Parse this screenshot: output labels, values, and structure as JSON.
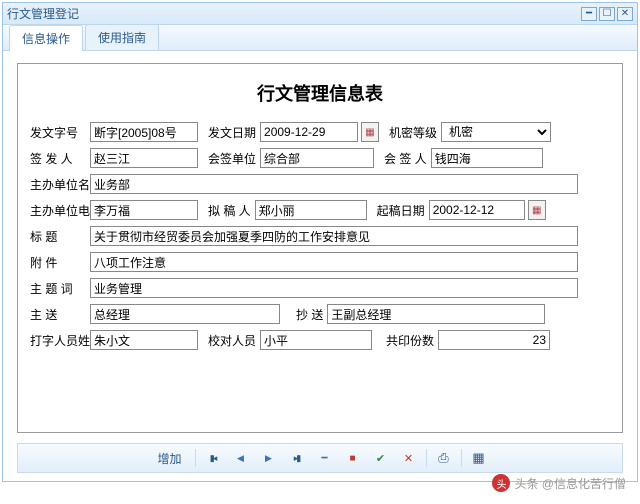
{
  "window": {
    "title": "行文管理登记"
  },
  "tabs": {
    "active": "信息操作",
    "other": "使用指南"
  },
  "form": {
    "title": "行文管理信息表",
    "labels": {
      "doc_no": "发文字号",
      "issue_date": "发文日期",
      "secrecy": "机密等级",
      "signer": "签 发 人",
      "cosign_unit": "会签单位",
      "cosigner": "会  签  人",
      "host_unit": "主办单位名",
      "host_phone": "主办单位电",
      "drafter": "拟  稿  人",
      "draft_date": "起稿日期",
      "title_lbl": "标        题",
      "attach": "附        件",
      "subject": "主  题  词",
      "main_send": "主        送",
      "cc_send": "抄        送",
      "typist": "打字人员姓",
      "proof": "校对人员",
      "copies": "共印份数"
    },
    "values": {
      "doc_no": "断字[2005]08号",
      "issue_date": "2009-12-29",
      "secrecy": "机密",
      "signer": "赵三江",
      "cosign_unit": "综合部",
      "cosigner": "钱四海",
      "host_unit": "业务部",
      "host_phone": "李万福",
      "drafter": "郑小丽",
      "draft_date": "2002-12-12",
      "title_val": "关于贯彻市经贸委员会加强夏季四防的工作安排意见",
      "attach": "八项工作注意",
      "subject": "业务管理",
      "main_send": "总经理",
      "cc_send": "王副总经理",
      "typist": "朱小文",
      "proof": "小平",
      "copies": "23"
    }
  },
  "toolbar": {
    "add": "增加"
  },
  "watermark": {
    "text": "头条 @信息化苦行僧",
    "avatar": "头"
  }
}
